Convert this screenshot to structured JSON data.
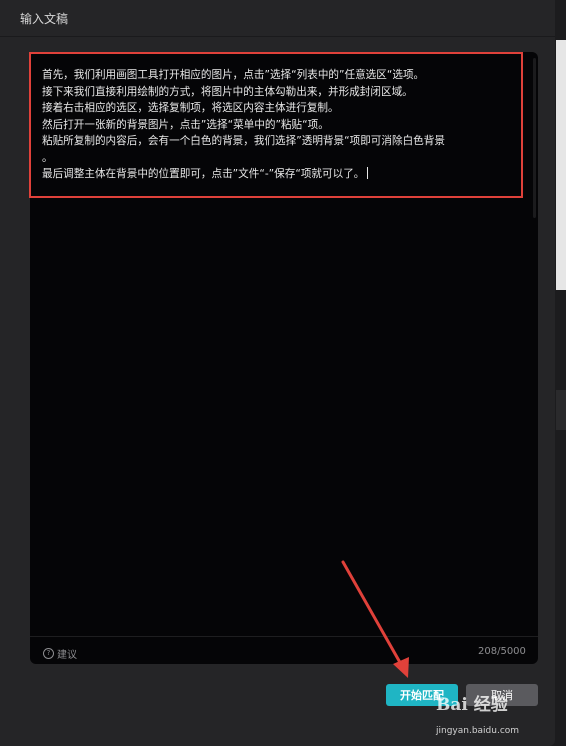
{
  "dialog": {
    "title": "输入文稿"
  },
  "editor": {
    "lines": [
      "首先，我们利用画图工具打开相应的图片，点击”选择“列表中的”任意选区“选项。",
      "接下来我们直接利用绘制的方式，将图片中的主体勾勒出来，并形成封闭区域。",
      "接着右击相应的选区，选择复制项，将选区内容主体进行复制。",
      "然后打开一张新的背景图片，点击”选择“菜单中的”粘贴“项。",
      "粘贴所复制的内容后，会有一个白色的背景，我们选择”透明背景“项即可消除白色背景",
      "。",
      "最后调整主体在背景中的位置即可，点击”文件“-”保存“项就可以了。"
    ],
    "highlight_color": "#e0413a"
  },
  "footer": {
    "suggest_label": "建议",
    "suggest_icon": "question-circle-icon",
    "char_count": "208/5000"
  },
  "buttons": {
    "start_label": "开始匹配",
    "cancel_label": "取消",
    "accent_color": "#1fb5c4"
  },
  "watermark": {
    "logo": "Bai 经验",
    "url": "jingyan.baidu.com"
  }
}
